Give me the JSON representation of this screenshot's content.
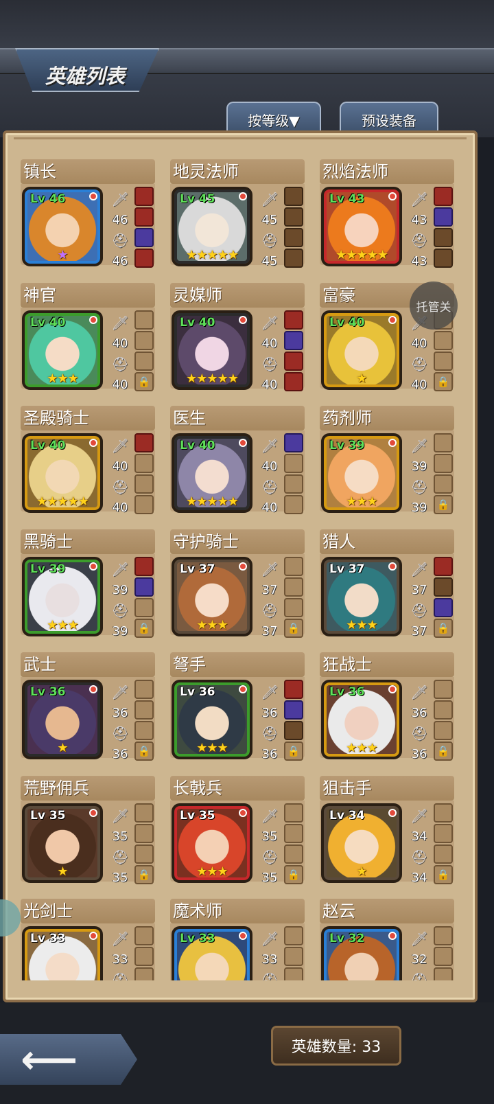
{
  "header": {
    "title": "英雄列表",
    "sort_button": "按等级▼",
    "preset_button": "预设装备"
  },
  "float_button": "托管关",
  "footer": {
    "hero_count": "英雄数量: 33"
  },
  "heroes": [
    {
      "name": "镇长",
      "lv": "Lv 46",
      "atk": "46",
      "def": "46",
      "stars": "★",
      "purple": true,
      "frame": "#2a7fd6",
      "lvc": "#5fe05a",
      "skin": "#f4d2b0",
      "hair": "#d9862c",
      "bg": "#3d6fb4",
      "slots": [
        "filled",
        "filled",
        "filled purple",
        "filled"
      ]
    },
    {
      "name": "地灵法师",
      "lv": "Lv 45",
      "atk": "45",
      "def": "45",
      "stars": "★★★★★",
      "purple": false,
      "frame": "#2b2b2b",
      "lvc": "#5fe05a",
      "skin": "#f2e6d8",
      "hair": "#d9d9d9",
      "bg": "#5c6d6a",
      "slots": [
        "filled brown",
        "filled brown",
        "filled brown",
        "filled brown"
      ]
    },
    {
      "name": "烈焰法师",
      "lv": "Lv 43",
      "atk": "43",
      "def": "43",
      "stars": "★★★★★",
      "purple": false,
      "frame": "#c6282b",
      "lvc": "#5fe05a",
      "skin": "#f7d3bd",
      "hair": "#ec7a1d",
      "bg": "#b04a2a",
      "slots": [
        "filled",
        "filled purple",
        "filled brown",
        "filled brown"
      ]
    },
    {
      "name": "神官",
      "lv": "Lv 40",
      "atk": "40",
      "def": "40",
      "stars": "★★★",
      "purple": false,
      "frame": "#3c9c2c",
      "lvc": "#5fe05a",
      "skin": "#f5dcc6",
      "hair": "#4fc7a0",
      "bg": "#4a8a5a",
      "slots": [
        "",
        "",
        "",
        "lock"
      ]
    },
    {
      "name": "灵媒师",
      "lv": "Lv 40",
      "atk": "40",
      "def": "40",
      "stars": "★★★★★",
      "purple": false,
      "frame": "#2b2b2b",
      "lvc": "#5fe05a",
      "skin": "#f0d6e4",
      "hair": "#5d4a6a",
      "bg": "#3b2e3e",
      "slots": [
        "filled",
        "filled purple",
        "filled",
        "filled"
      ]
    },
    {
      "name": "富豪",
      "lv": "Lv 40",
      "atk": "40",
      "def": "40",
      "stars": "★",
      "purple": false,
      "frame": "#d69a12",
      "lvc": "#5fe05a",
      "skin": "#f4d9b8",
      "hair": "#e8c23a",
      "bg": "#9a7a2a",
      "slots": [
        "",
        "",
        "",
        "lock"
      ]
    },
    {
      "name": "圣殿骑士",
      "lv": "Lv 40",
      "atk": "40",
      "def": "40",
      "stars": "★★★★★",
      "purple": false,
      "frame": "#d69a12",
      "lvc": "#5fe05a",
      "skin": "#f2d8b4",
      "hair": "#e7cf88",
      "bg": "#8a6a30",
      "slots": [
        "filled",
        "",
        "",
        ""
      ]
    },
    {
      "name": "医生",
      "lv": "Lv 40",
      "atk": "40",
      "def": "40",
      "stars": "★★★★★",
      "purple": false,
      "frame": "#2b2b2b",
      "lvc": "#5fe05a",
      "skin": "#f3ddd0",
      "hair": "#8e86a8",
      "bg": "#4e4a5e",
      "slots": [
        "filled purple",
        "",
        "",
        ""
      ]
    },
    {
      "name": "药剂师",
      "lv": "Lv 39",
      "atk": "39",
      "def": "39",
      "stars": "★★★",
      "purple": false,
      "frame": "#d69a12",
      "lvc": "#5fe05a",
      "skin": "#f6dcc4",
      "hair": "#f0a560",
      "bg": "#b08040",
      "slots": [
        "",
        "",
        "",
        "lock"
      ]
    },
    {
      "name": "黑骑士",
      "lv": "Lv 39",
      "atk": "39",
      "def": "39",
      "stars": "★★★",
      "purple": false,
      "frame": "#3c9c2c",
      "lvc": "#5fe05a",
      "skin": "#e8dfe0",
      "hair": "#e9e9ee",
      "bg": "#3a3f48",
      "slots": [
        "filled",
        "filled purple",
        "",
        "lock"
      ]
    },
    {
      "name": "守护骑士",
      "lv": "Lv 37",
      "atk": "37",
      "def": "37",
      "stars": "★★★",
      "purple": false,
      "frame": "#5a4a3a",
      "lvc": "#ffffff",
      "skin": "#f6dcc8",
      "hair": "#b06a3a",
      "bg": "#7a5a40",
      "slots": [
        "",
        "",
        "",
        "lock"
      ]
    },
    {
      "name": "猎人",
      "lv": "Lv 37",
      "atk": "37",
      "def": "37",
      "stars": "★★★",
      "purple": false,
      "frame": "#5a4a3a",
      "lvc": "#ffffff",
      "skin": "#f2dcc8",
      "hair": "#2f7a80",
      "bg": "#3e5a60",
      "slots": [
        "filled",
        "filled brown",
        "filled purple",
        "lock"
      ]
    },
    {
      "name": "武士",
      "lv": "Lv 36",
      "atk": "36",
      "def": "36",
      "stars": "★",
      "purple": false,
      "frame": "#2b2b2b",
      "lvc": "#5fe05a",
      "skin": "#e6b890",
      "hair": "#4a3a68",
      "bg": "#4a3050",
      "slots": [
        "",
        "",
        "",
        "lock"
      ]
    },
    {
      "name": "弩手",
      "lv": "Lv 36",
      "atk": "36",
      "def": "36",
      "stars": "★★★",
      "purple": false,
      "frame": "#3c9c2c",
      "lvc": "#ffffff",
      "skin": "#f2dcc4",
      "hair": "#2f3a46",
      "bg": "#3e4a40",
      "slots": [
        "filled",
        "filled purple",
        "filled brown",
        "lock"
      ]
    },
    {
      "name": "狂战士",
      "lv": "Lv 36",
      "atk": "36",
      "def": "36",
      "stars": "★★★",
      "purple": false,
      "frame": "#d69a12",
      "lvc": "#5fe05a",
      "skin": "#f0d0c0",
      "hair": "#eaeaea",
      "bg": "#6a4030",
      "slots": [
        "",
        "",
        "",
        "lock"
      ]
    },
    {
      "name": "荒野佣兵",
      "lv": "Lv 35",
      "atk": "35",
      "def": "35",
      "stars": "★",
      "purple": false,
      "frame": "#5a4a3a",
      "lvc": "#ffffff",
      "skin": "#f0c8a8",
      "hair": "#4a2e1e",
      "bg": "#5a3a2a",
      "slots": [
        "",
        "",
        "",
        "lock"
      ]
    },
    {
      "name": "长戟兵",
      "lv": "Lv 35",
      "atk": "35",
      "def": "35",
      "stars": "★★★",
      "purple": false,
      "frame": "#c6282b",
      "lvc": "#ffffff",
      "skin": "#f4d0b4",
      "hair": "#d8452a",
      "bg": "#7a3020",
      "slots": [
        "",
        "",
        "",
        "lock"
      ]
    },
    {
      "name": "狙击手",
      "lv": "Lv 34",
      "atk": "34",
      "def": "34",
      "stars": "★",
      "purple": false,
      "frame": "#5a4a3a",
      "lvc": "#ffffff",
      "skin": "#f6dcc0",
      "hair": "#f0b030",
      "bg": "#5a4a30",
      "slots": [
        "",
        "",
        "",
        "lock"
      ]
    },
    {
      "name": "光剑士",
      "lv": "Lv 33",
      "atk": "33",
      "def": "",
      "stars": "",
      "purple": false,
      "frame": "#d69a12",
      "lvc": "#ffffff",
      "skin": "#f4dcc8",
      "hair": "#ececec",
      "bg": "#8a6a40",
      "slots": [
        "",
        "",
        "",
        ""
      ]
    },
    {
      "name": "魔术师",
      "lv": "Lv 33",
      "atk": "33",
      "def": "",
      "stars": "",
      "purple": false,
      "frame": "#2a7fd6",
      "lvc": "#5fe05a",
      "skin": "#f4d8b8",
      "hair": "#e8c040",
      "bg": "#2e4a7a",
      "slots": [
        "",
        "",
        "",
        ""
      ]
    },
    {
      "name": "赵云",
      "lv": "Lv 32",
      "atk": "32",
      "def": "",
      "stars": "",
      "purple": false,
      "frame": "#2a7fd6",
      "lvc": "#5fe05a",
      "skin": "#f0d0b4",
      "hair": "#b8642a",
      "bg": "#3a5a8a",
      "slots": [
        "",
        "",
        "",
        ""
      ]
    }
  ]
}
